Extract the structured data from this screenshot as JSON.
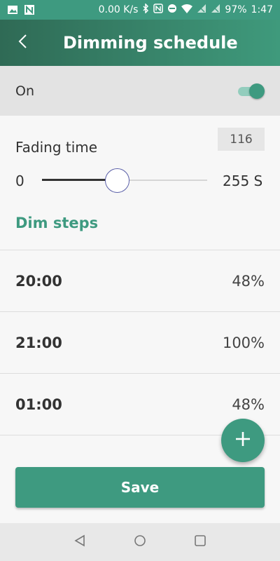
{
  "status_bar": {
    "speed": "0.00 K/s",
    "battery": "97%",
    "time": "1:47",
    "color": "#3e9a80"
  },
  "app_bar": {
    "title": "Dimming schedule"
  },
  "schedule_toggle": {
    "label": "On",
    "enabled": true
  },
  "fading_time": {
    "label": "Fading time",
    "value": "116",
    "min_label": "0",
    "max_label": "255 S",
    "min": 0,
    "max": 255,
    "current": 116
  },
  "dim_steps": {
    "title": "Dim steps",
    "items": [
      {
        "time": "20:00",
        "level": "48%"
      },
      {
        "time": "21:00",
        "level": "100%"
      },
      {
        "time": "01:00",
        "level": "48%"
      }
    ]
  },
  "actions": {
    "save_label": "Save",
    "add_icon": "plus-icon"
  },
  "theme": {
    "accent": "#3e9a80",
    "app_bar_dark": "#2f6a55"
  }
}
